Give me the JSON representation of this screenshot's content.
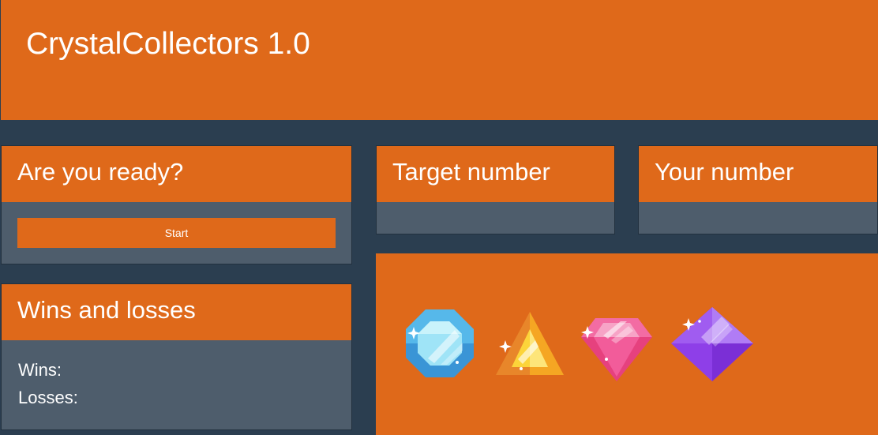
{
  "app": {
    "title": "CrystalCollectors 1.0"
  },
  "ready_panel": {
    "heading": "Are you ready?",
    "start_label": "Start"
  },
  "target_panel": {
    "heading": "Target number",
    "value": ""
  },
  "your_panel": {
    "heading": "Your number",
    "value": ""
  },
  "score_panel": {
    "heading": "Wins and losses",
    "wins_label": "Wins:",
    "wins_value": "",
    "losses_label": "Losses:",
    "losses_value": ""
  },
  "crystals": [
    {
      "icon": "blue-octagon-crystal-icon",
      "color": "#5bc8f2"
    },
    {
      "icon": "orange-triangle-crystal-icon",
      "color": "#f6a623"
    },
    {
      "icon": "pink-diamond-crystal-icon",
      "color": "#f25c9a"
    },
    {
      "icon": "purple-gem-crystal-icon",
      "color": "#9b4df2"
    }
  ],
  "colors": {
    "accent": "#df691a",
    "background": "#2b3e50",
    "panel_body": "#4e5d6c",
    "text": "#ffffff"
  }
}
